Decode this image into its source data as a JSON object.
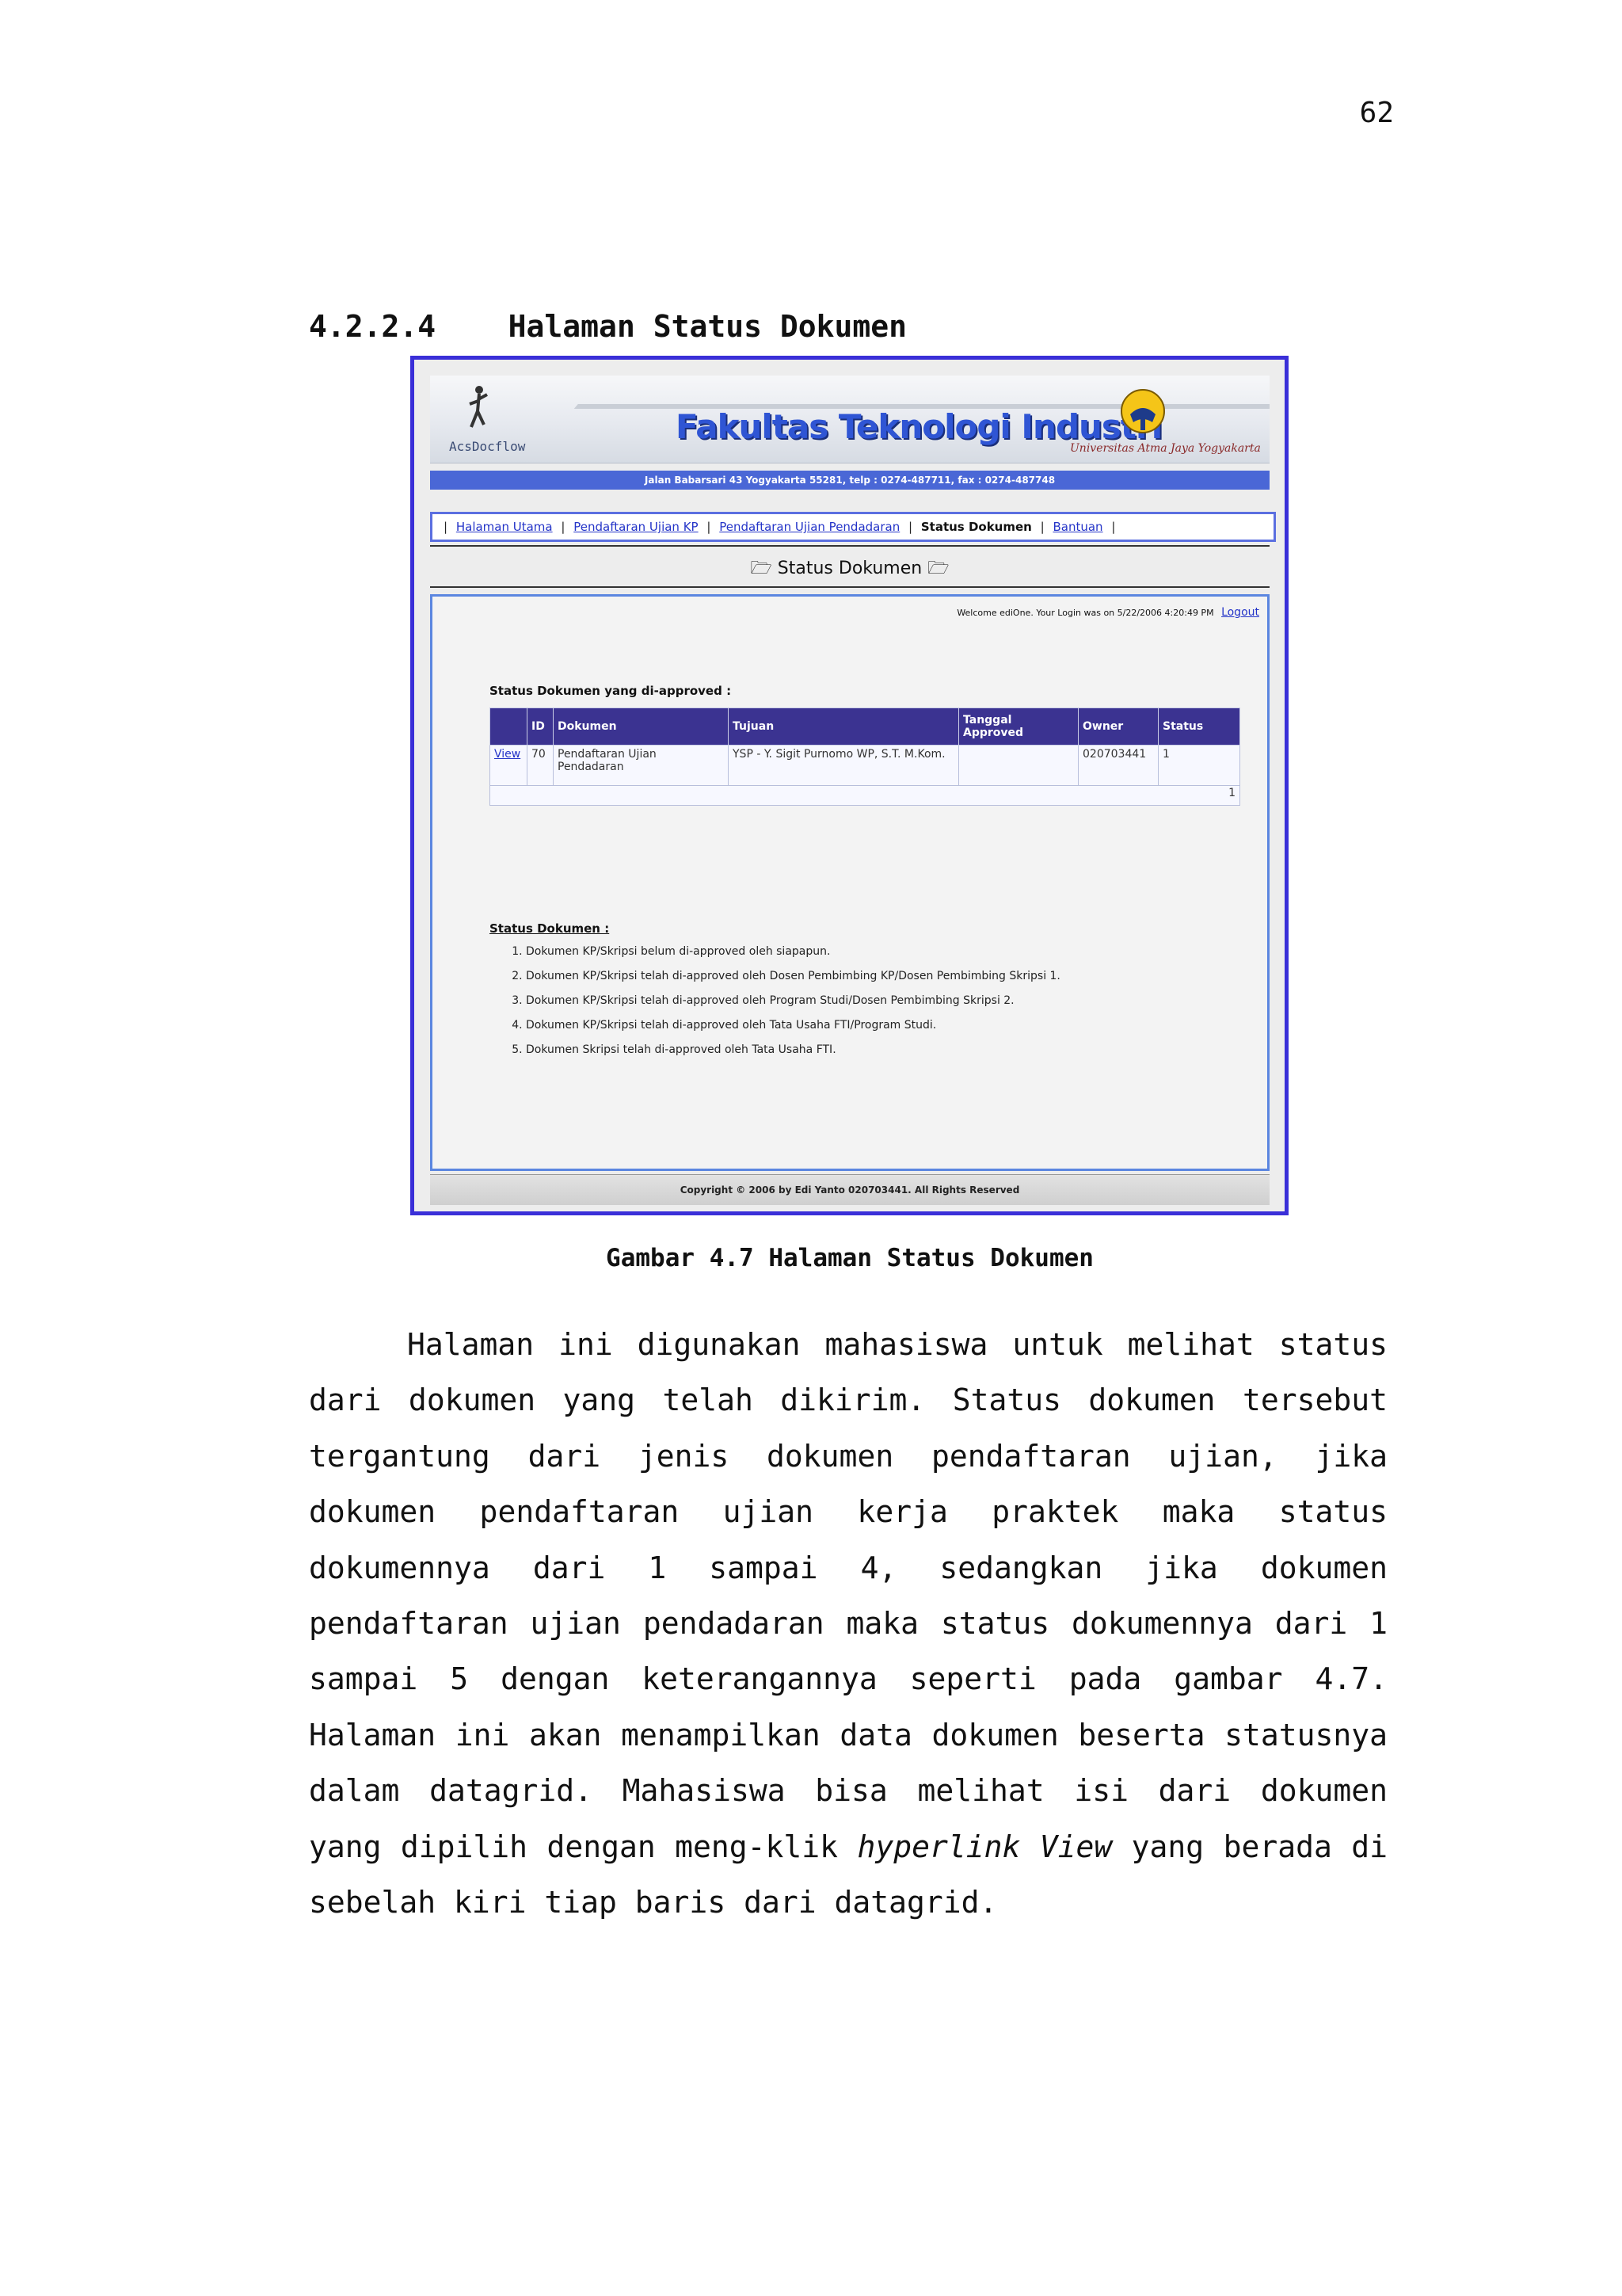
{
  "page_number": "62",
  "section": {
    "number": "4.2.2.4",
    "title": "Halaman Status Dokumen"
  },
  "screenshot": {
    "brand_small": "AcsDocflow",
    "faculty_title": "Fakultas Teknologi Industri",
    "university": "Universitas Atma Jaya Yogyakarta",
    "address": "Jalan Babarsari 43 Yogyakarta 55281, telp : 0274-487711, fax : 0274-487748",
    "nav": [
      {
        "label": "Halaman Utama"
      },
      {
        "label": "Pendaftaran Ujian KP"
      },
      {
        "label": "Pendaftaran Ujian Pendadaran"
      },
      {
        "label": "Status Dokumen"
      },
      {
        "label": "Bantuan"
      }
    ],
    "page_subtitle": "Status Dokumen",
    "welcome_text": "Welcome ediOne. Your Login was on 5/22/2006 4:20:49 PM",
    "logout_label": "Logout",
    "approved_title": "Status Dokumen yang di-approved :",
    "table": {
      "headers": [
        "",
        "ID",
        "Dokumen",
        "Tujuan",
        "Tanggal Approved",
        "Owner",
        "Status"
      ],
      "row": {
        "view": "View",
        "id": "70",
        "dokumen": "Pendaftaran Ujian Pendadaran",
        "tujuan": "YSP - Y. Sigit Purnomo WP, S.T. M.Kom.",
        "tanggal": "",
        "owner": "020703441",
        "status": "1"
      },
      "pager": "1"
    },
    "legend_title": "Status Dokumen :",
    "legend": [
      "Dokumen KP/Skripsi belum di-approved oleh siapapun.",
      "Dokumen KP/Skripsi telah di-approved oleh Dosen Pembimbing KP/Dosen Pembimbing Skripsi 1.",
      "Dokumen KP/Skripsi telah di-approved oleh Program Studi/Dosen Pembimbing Skripsi 2.",
      "Dokumen KP/Skripsi telah di-approved oleh Tata Usaha FTI/Program Studi.",
      "Dokumen Skripsi telah di-approved oleh Tata Usaha FTI."
    ],
    "copyright": "Copyright © 2006 by Edi Yanto 020703441. All Rights Reserved"
  },
  "caption": "Gambar 4.7 Halaman Status Dokumen",
  "paragraph": {
    "part1": "Halaman ini digunakan mahasiswa untuk melihat status dari dokumen yang telah dikirim. Status dokumen tersebut tergantung dari jenis dokumen pendaftaran ujian, jika dokumen pendaftaran ujian kerja praktek maka status dokumennya dari 1 sampai 4, sedangkan jika dokumen pendaftaran ujian pendadaran maka status dokumennya dari 1 sampai 5 dengan keterangannya seperti pada gambar 4.7. Halaman ini akan menampilkan data dokumen beserta statusnya dalam datagrid. Mahasiswa bisa melihat isi dari dokumen yang dipilih dengan meng-klik",
    "italic": "hyperlink View",
    "part2": "yang berada di sebelah kiri tiap baris dari datagrid."
  }
}
